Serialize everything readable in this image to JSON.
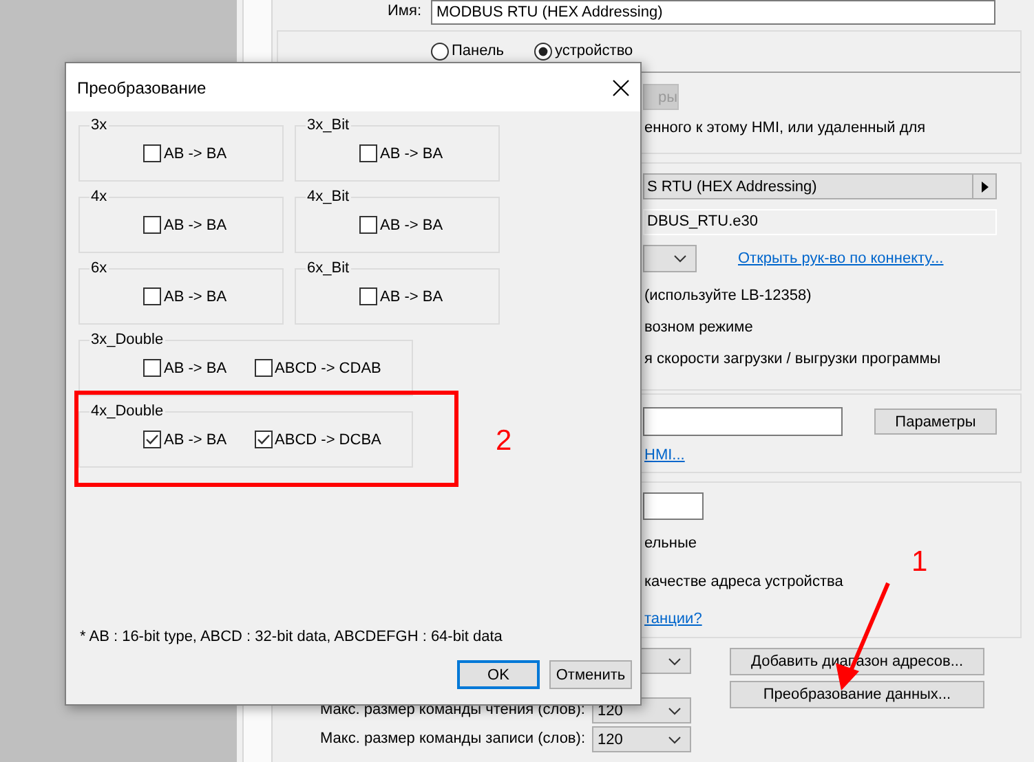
{
  "background": {
    "name_label": "Имя:",
    "name_value": "MODBUS RTU (HEX Addressing)",
    "radios": [
      {
        "label": "Панель",
        "selected": false
      },
      {
        "label": "устройство",
        "selected": true
      }
    ],
    "disabled_button": "ры",
    "location_note": "енного к этому HMI, или удаленный для",
    "device_type": "S RTU (HEX Addressing)",
    "device_file": "DBUS_RTU.e30",
    "manual_link": "Открыть рук-во по коннекту...",
    "options": [
      "(используйте LB-12358)",
      "возном режиме",
      "я скорости загрузки / выгрузки программы"
    ],
    "params_button": "Параметры",
    "hmi_link": "HMI...",
    "station_options": [
      "ельные",
      "качестве адреса устройства"
    ],
    "station_link": "танции?",
    "read_label": "Макс. размер команды чтения (слов):",
    "read_value": "120",
    "write_label": "Макс. размер команды записи (слов):",
    "write_value": "120",
    "add_range_button": "Добавить диапазон адресов...",
    "convert_button": "Преобразование данных..."
  },
  "dialog": {
    "title": "Преобразование",
    "groups": [
      {
        "title": "3x",
        "options": [
          {
            "label": "AB -> BA",
            "checked": false
          }
        ]
      },
      {
        "title": "3x_Bit",
        "options": [
          {
            "label": "AB -> BA",
            "checked": false
          }
        ]
      },
      {
        "title": "4x",
        "options": [
          {
            "label": "AB -> BA",
            "checked": false
          }
        ]
      },
      {
        "title": "4x_Bit",
        "options": [
          {
            "label": "AB -> BA",
            "checked": false
          }
        ]
      },
      {
        "title": "6x",
        "options": [
          {
            "label": "AB -> BA",
            "checked": false
          }
        ]
      },
      {
        "title": "6x_Bit",
        "options": [
          {
            "label": "AB -> BA",
            "checked": false
          }
        ]
      },
      {
        "title": "3x_Double",
        "options": [
          {
            "label": "AB -> BA",
            "checked": false
          },
          {
            "label": "ABCD -> CDAB",
            "checked": false
          }
        ]
      },
      {
        "title": "4x_Double",
        "options": [
          {
            "label": "AB -> BA",
            "checked": true
          },
          {
            "label": "ABCD -> DCBA",
            "checked": true
          }
        ]
      }
    ],
    "footnote": "* AB : 16-bit type, ABCD : 32-bit data, ABCDEFGH : 64-bit data",
    "buttons": [
      {
        "label": "OK",
        "default": true
      },
      {
        "label": "Отменить",
        "default": false
      }
    ]
  },
  "annotations": [
    {
      "kind": "highlight",
      "label": "2"
    },
    {
      "kind": "arrow",
      "label": "1"
    }
  ]
}
